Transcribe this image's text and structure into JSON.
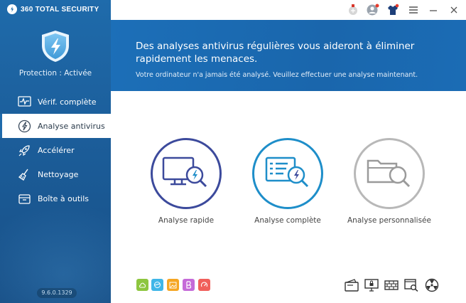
{
  "app": {
    "brand": "360 TOTAL SECURITY"
  },
  "sidebar": {
    "protection_status": "Protection : Activée",
    "items": [
      {
        "label": "Vérif. complète",
        "icon": "heartbeat-monitor-icon"
      },
      {
        "label": "Analyse antivirus",
        "icon": "lightning-circle-icon",
        "active": true
      },
      {
        "label": "Accélérer",
        "icon": "rocket-icon"
      },
      {
        "label": "Nettoyage",
        "icon": "broom-icon"
      },
      {
        "label": "Boîte à outils",
        "icon": "toolbox-icon"
      }
    ],
    "version": "9.6.0.1329"
  },
  "banner": {
    "title": "Des analyses antivirus régulières vous aideront à éliminer rapidement les menaces.",
    "subtitle": "Votre ordinateur n'a jamais été analysé. Veuillez effectuer une analyse maintenant."
  },
  "scans": [
    {
      "label": "Analyse rapide",
      "color": "#3c4a9c"
    },
    {
      "label": "Analyse complète",
      "color": "#1e8ec9"
    },
    {
      "label": "Analyse personnalisée",
      "color": "#b8b8b8"
    }
  ],
  "colors": {
    "sidebar": "#1c5f9c",
    "banner": "#1c6fb8",
    "accent": "#1f6bab"
  }
}
